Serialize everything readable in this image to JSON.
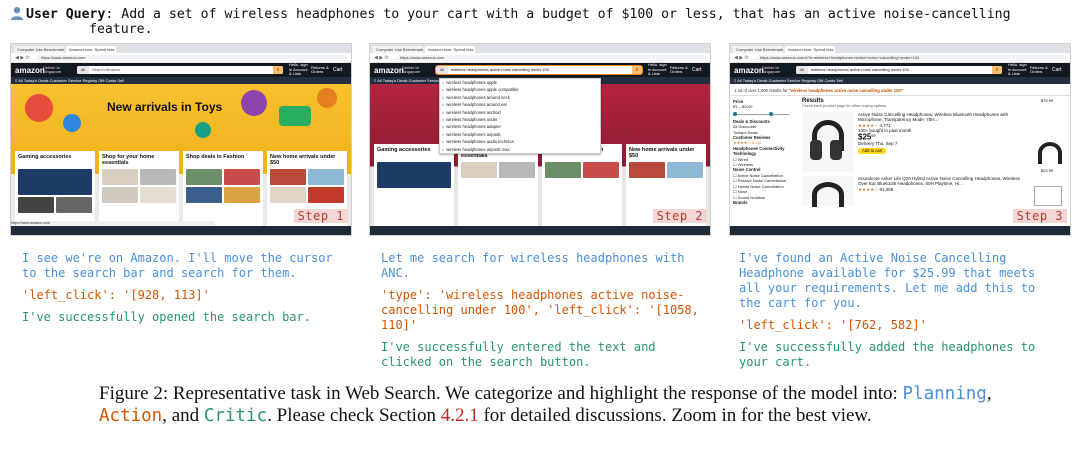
{
  "query": {
    "label": "User Query",
    "text_line1": ": Add a set of wireless headphones to your cart with a budget of $100 or less, that has an active noise-cancelling",
    "text_line2": "feature."
  },
  "browser": {
    "tab_active": "Amazon.com. Spend less. Sm",
    "tab_other": "Computer Use Benchmark",
    "url_home": "https://www.amazon.com",
    "url_results": "https://www.amazon.com/s?k=wireless+headphones+active+noise+cancelling+under+100"
  },
  "amazon": {
    "logo": "amazon",
    "deliver": "Deliver to Singapore",
    "search_all": "All",
    "search_placeholder": "Search Amazon",
    "search_query": "wireless headphones active noise cancelling under 100",
    "account": "Hello, sign in Account & Lists",
    "returns": "Returns & Orders",
    "cart": "Cart",
    "nav": "≡ All   Today's Deals   Customer Service   Registry   Gift Cards   Sell"
  },
  "home": {
    "hero_title": "New arrivals in Toys",
    "cards": [
      {
        "title": "Gaming accessories"
      },
      {
        "title": "Shop for your home essentials"
      },
      {
        "title": "Shop deals in Fashion"
      },
      {
        "title": "New home arrivals under $50"
      }
    ]
  },
  "autocomplete": [
    "wireless headphones apple",
    "wireless headphones apple compatible",
    "wireless headphones around neck",
    "wireless headphones around ear",
    "wireless headphones android",
    "wireless headphones under",
    "wireless headphones adapter",
    "wireless headphones airpods",
    "wireless headphones audio technica",
    "wireless headphones airpods max"
  ],
  "results": {
    "count_text": "1-16 of over 1,000 results for",
    "count_query": "\"wireless headphones active noise cancelling under 100\"",
    "heading": "Results",
    "subheading": "Check each product page for other buying options.",
    "filters": {
      "price_label": "Price",
      "price_range": "$7 – $200+",
      "deals_label": "Deals & Discounts",
      "deals_items": [
        "All Discounts",
        "Today's Deals"
      ],
      "review_label": "Customer Reviews",
      "review_value": "★★★★☆ & Up",
      "tech_label": "Headphones Connectivity Technology",
      "tech_items": [
        "Wired",
        "Wireless"
      ],
      "noise_label": "Noise Control",
      "noise_items": [
        "Active Noise Cancellation",
        "Passive Noise Cancellation",
        "Hybrid Noise Cancellation",
        "None",
        "Sound Isolation"
      ],
      "brands_label": "Brands"
    },
    "products": [
      {
        "title": "Active Noise Cancelling Headphones, Wireless Bluetooth Headphones with Microphone, Transparency Mode, 70H...",
        "rating": "★★★★☆",
        "reviews": "4,771",
        "bought": "100+ bought in past month",
        "price": "$25",
        "price_cents": "99",
        "delivery": "Delivery Thu, Sep 7",
        "add_label": "Add to cart"
      },
      {
        "title": "Soundcore Anker Life Q20 Hybrid Active Noise Cancelling Headphones, Wireless Over Ear Bluetooth Headphones, 60H Playtime, Hi...",
        "rating": "★★★★☆",
        "reviews": "81,085",
        "bought": "",
        "price": "",
        "price_cents": "",
        "delivery": "",
        "add_label": ""
      }
    ],
    "side_prices": [
      "$79.99",
      "$23.99",
      "$50.00"
    ]
  },
  "steps": [
    {
      "badge": "Step 1",
      "planning": "I see we're on Amazon. I'll move the cursor to the search bar and search for them.",
      "action": "'left_click': '[928, 113]'",
      "critic": "I've successfully opened the search bar."
    },
    {
      "badge": "Step 2",
      "planning": "Let me search for wireless headphones with ANC.",
      "action": "'type': 'wireless headphones active noise-cancelling under 100', 'left_click': '[1058, 110]'",
      "critic": "I've successfully entered the text and clicked on the search button."
    },
    {
      "badge": "Step 3",
      "planning": "I've found an Active Noise Cancelling Headphone available for $25.99 that meets all your requirements. Let me add this to the cart for you.",
      "action": "'left_click': '[762, 582]'",
      "critic": "I've successfully added the headphones to your cart."
    }
  ],
  "caption": {
    "lead": "Figure 2: Representative task in Web Search. We categorize and highlight the response of the model into: ",
    "planning": "Planning",
    "sep1": ", ",
    "action": "Action",
    "sep2": ", and ",
    "critic": "Critic",
    "mid": ". Please check Section ",
    "section": "4.2.1",
    "tail": " for detailed discussions. Zoom in for the best view."
  },
  "colors": {
    "planning": "#4a90d9",
    "action": "#d35400",
    "critic": "#27956b",
    "badge": "#c0392b",
    "amazon_dark": "#131921"
  }
}
